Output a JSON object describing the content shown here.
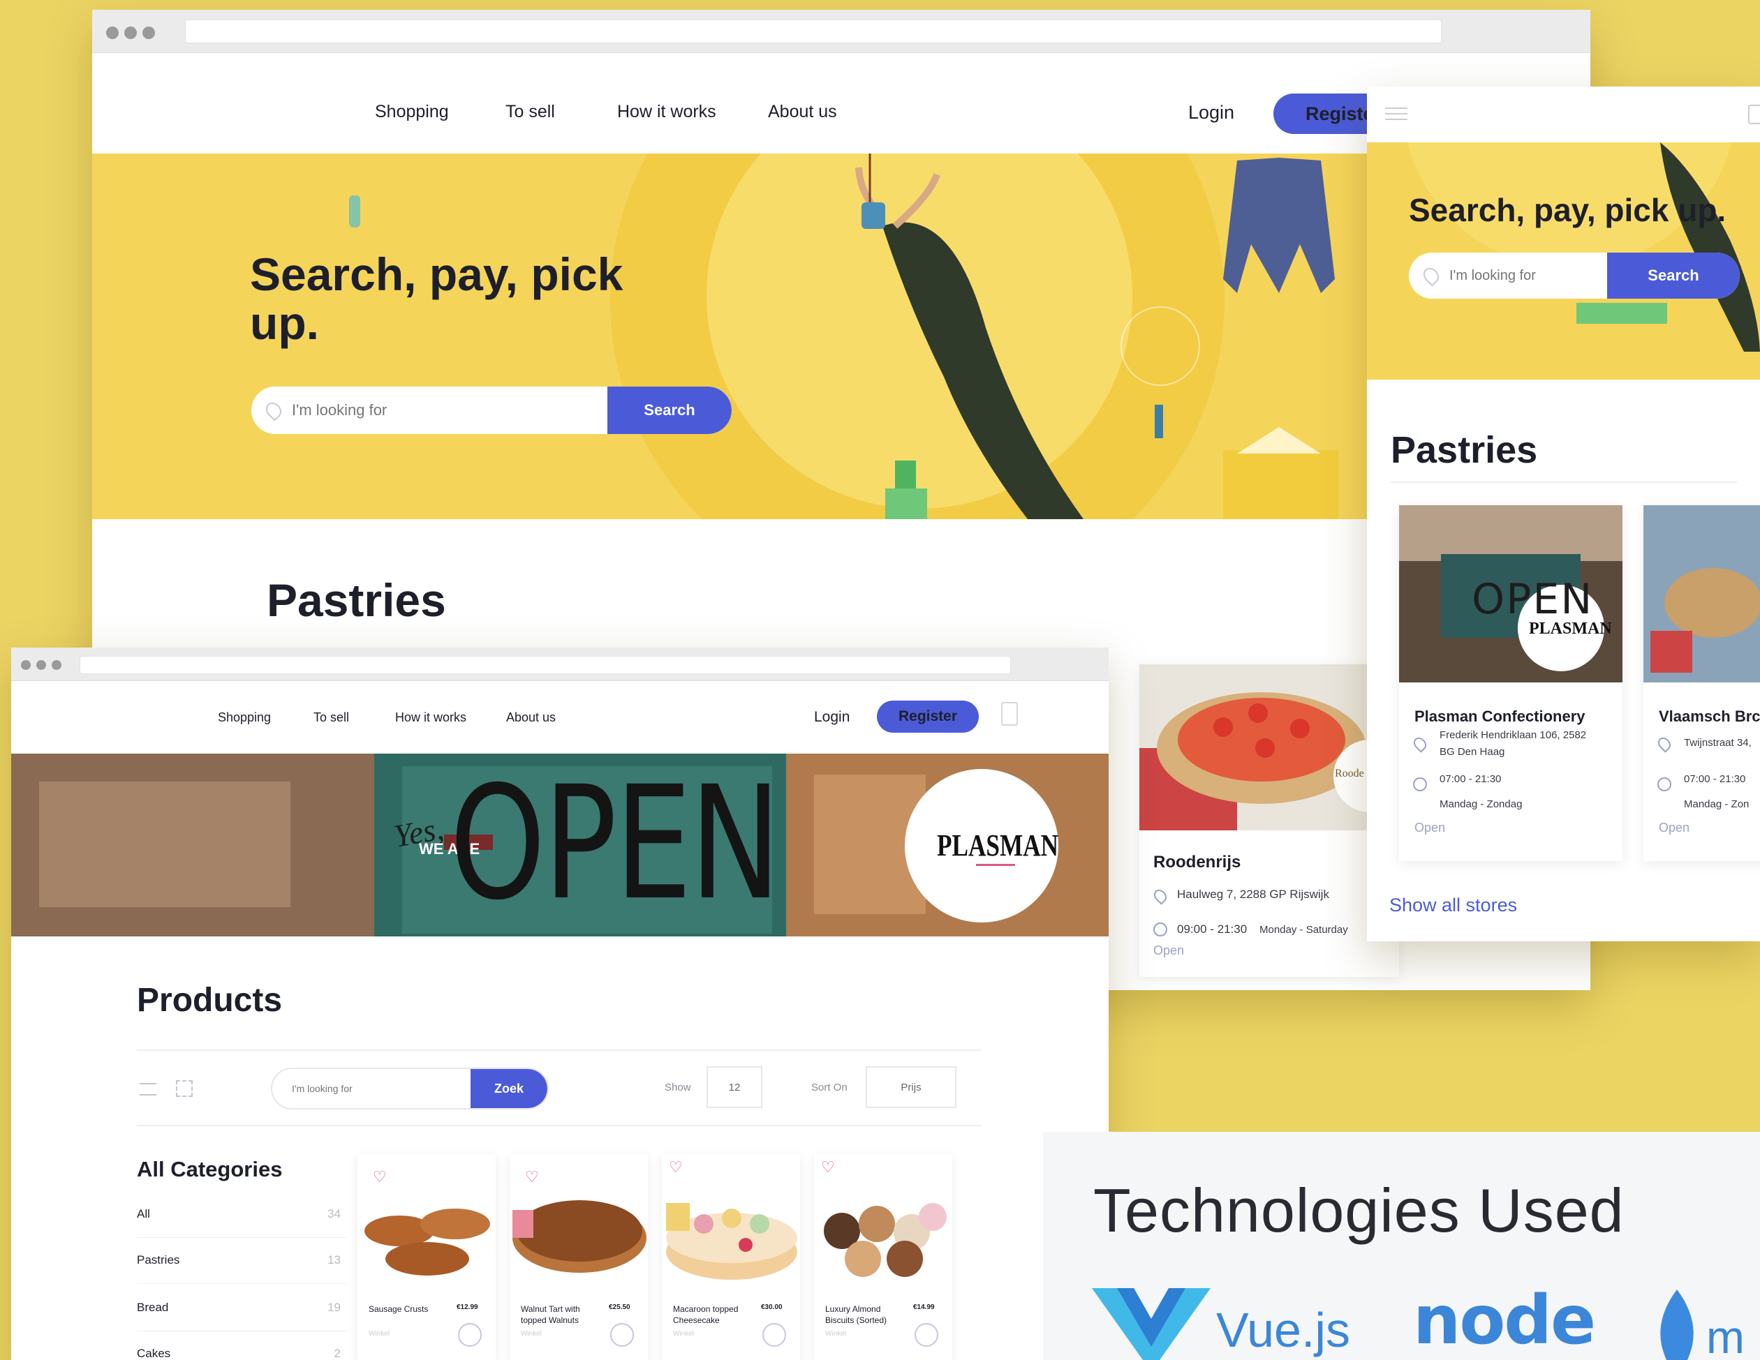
{
  "nav": {
    "shopping": "Shopping",
    "to_sell": "To sell",
    "how_it_works": "How it works",
    "about_us": "About us",
    "login": "Login",
    "register": "Register",
    "register_cut": "Registe"
  },
  "hero": {
    "title_line1": "Search, pay, pick",
    "title_line2": "up.",
    "title_mobile": "Search, pay, pick up.",
    "search_placeholder": "I'm looking for",
    "search_button": "Search"
  },
  "pastries": {
    "heading": "Pastries",
    "show_all": "Show all stores"
  },
  "stores": [
    {
      "name": "Roodenrijs",
      "address": "Haulweg 7, 2288 GP Rijswijk",
      "hours": "09:00 - 21:30",
      "days": "Monday - Saturday",
      "status": "Open",
      "logo_text": "Roode"
    },
    {
      "name": "Plasman Confectionery",
      "address": "Frederik Hendriklaan 106, 2582 BG Den Haag",
      "hours": "07:00 - 21:30",
      "days": "Mandag - Zondag",
      "status": "Open",
      "logo_text": "PLASMAN"
    },
    {
      "name": "Vlaamsch Brc",
      "address": "Twijnstraat 34,",
      "hours": "07:00 - 21:30",
      "days": "Mandag - Zon",
      "status": "Open"
    }
  ],
  "store_page": {
    "sign_yes": "Yes,",
    "sign_we_are": "WE ARE",
    "sign_open": "OPEN",
    "logo": "PLASMAN",
    "products_heading": "Products",
    "search_placeholder": "I'm looking for",
    "search_button": "Zoek",
    "show_label": "Show",
    "show_value": "12",
    "sort_label": "Sort On",
    "sort_value": "Prijs",
    "categories_heading": "All Categories",
    "categories": [
      {
        "name": "All",
        "count": "34"
      },
      {
        "name": "Pastries",
        "count": "13"
      },
      {
        "name": "Bread",
        "count": "19"
      },
      {
        "name": "Cakes",
        "count": "2"
      }
    ],
    "products": [
      {
        "name": "Sausage Crusts",
        "price": "€12.99",
        "sub": "Winkel"
      },
      {
        "name": "Walnut Tart with topped Walnuts",
        "price": "€25.50",
        "sub": "Winkel"
      },
      {
        "name": "Macaroon topped Cheesecake",
        "price": "€30.00",
        "sub": "Winkel"
      },
      {
        "name": "Luxury Almond Biscuits (Sorted)",
        "price": "€14.99",
        "sub": "Winkel"
      }
    ]
  },
  "tech": {
    "heading": "Technologies Used",
    "vue": "Vue.js",
    "node": "node",
    "mongo": "m"
  },
  "colors": {
    "background": "#ecd463",
    "accent": "#4b5bd8",
    "hero_yellow": "#f5d45a",
    "heart": "#e05a86"
  }
}
